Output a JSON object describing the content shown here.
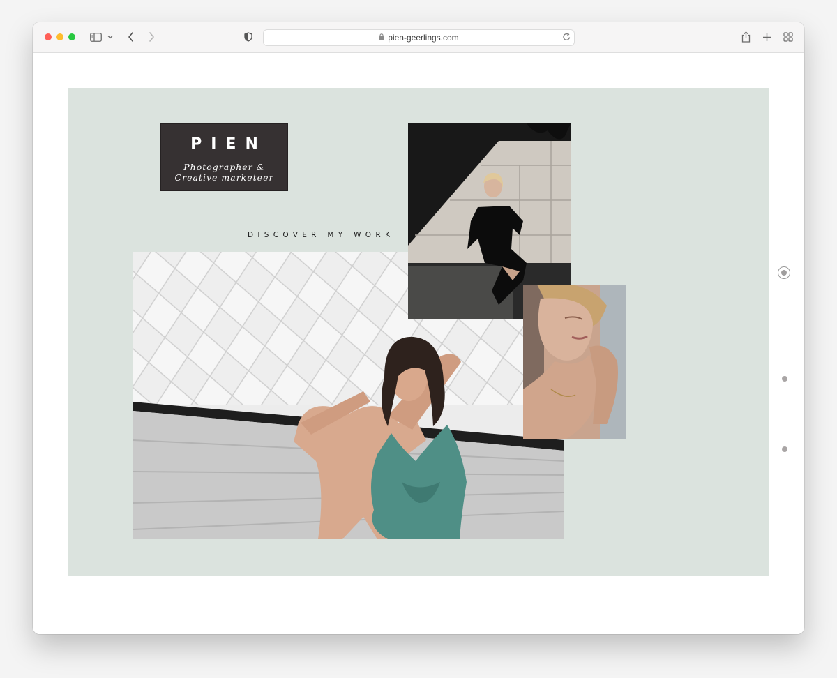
{
  "browser": {
    "url": "pien-geerlings.com"
  },
  "site": {
    "logo_name": "PIEN",
    "logo_tagline_line1": "Photographer &",
    "logo_tagline_line2": "Creative marketeer",
    "discover_label": "DISCOVER MY WORK",
    "background_color": "#dbe3de"
  },
  "gallery": [
    {
      "name": "woman-teal-dress-photo"
    },
    {
      "name": "woman-black-dress-photo"
    },
    {
      "name": "woman-closeup-portrait-photo"
    }
  ],
  "slide_nav": {
    "count": 3,
    "active_index": 0
  }
}
